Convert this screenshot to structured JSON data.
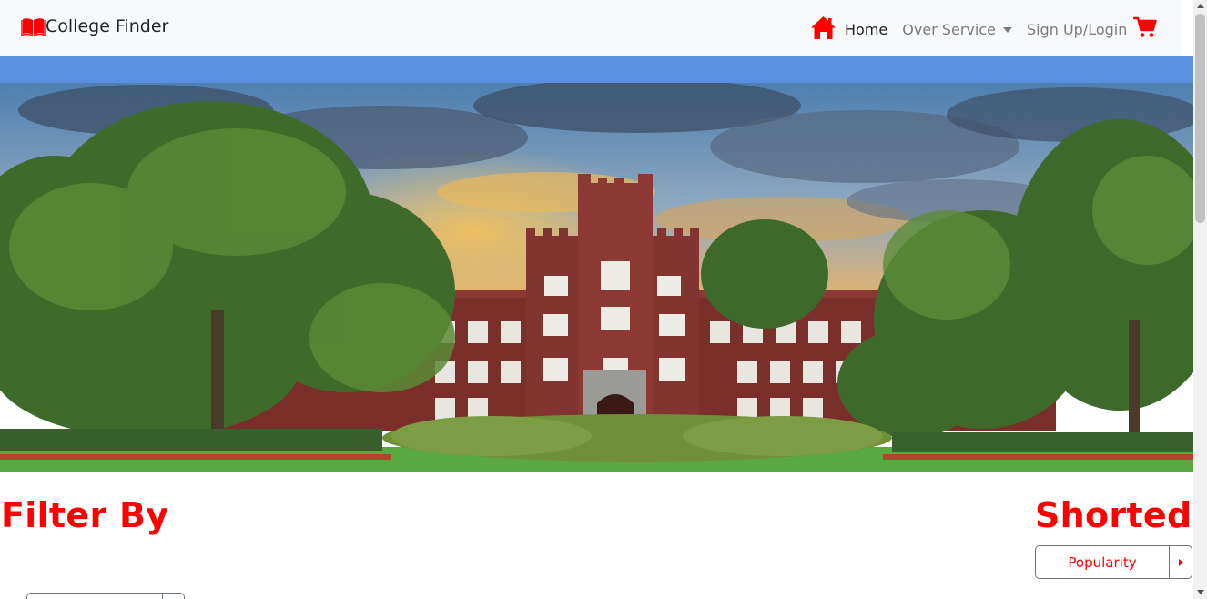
{
  "navbar": {
    "brand_title": "College Finder",
    "brand_icon": "book-icon",
    "home_icon": "home-icon",
    "home_label": "Home",
    "service_label": "Over Service",
    "signup_label": "Sign Up/Login",
    "cart_icon": "cart-icon"
  },
  "hero": {
    "image": "college-campus-building-photo"
  },
  "filter": {
    "title": "Filter By"
  },
  "sort": {
    "title": "Shorted",
    "selected_label": "Popularity"
  },
  "colors": {
    "accent": "#ff0000",
    "strip": "#5b8fe0",
    "navbar_bg": "#f8f9fa"
  }
}
